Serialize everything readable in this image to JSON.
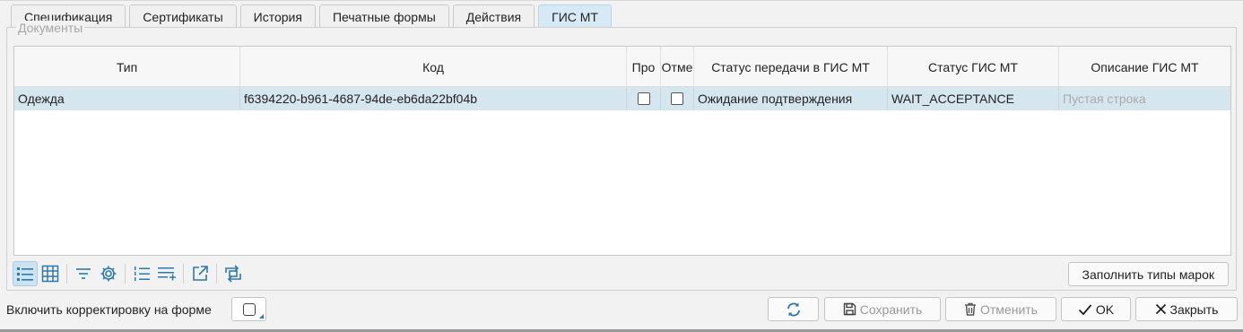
{
  "tabs": [
    {
      "label": "Спецификация"
    },
    {
      "label": "Сертификаты"
    },
    {
      "label": "История"
    },
    {
      "label": "Печатные формы"
    },
    {
      "label": "Действия"
    },
    {
      "label": "ГИС МТ",
      "active": true
    }
  ],
  "group": {
    "title": "Документы"
  },
  "grid": {
    "columns": [
      "Тип",
      "Код",
      "Про",
      "Отме",
      "Статус передачи в ГИС МТ",
      "Статус ГИС МТ",
      "Описание ГИС МТ"
    ],
    "rows": [
      {
        "type": "Одежда",
        "code": "f6394220-b961-4687-94de-eb6da22bf04b",
        "pro": false,
        "otme": false,
        "transfer_status": "Ожидание подтверждения",
        "gis_status": "WAIT_ACCEPTANCE",
        "description_placeholder": "Пустая строка"
      }
    ]
  },
  "toolbar": {
    "icons": [
      "list-view-icon",
      "table-view-icon",
      "filter-icon",
      "settings-gear-icon",
      "numbered-list-icon",
      "add-rows-icon",
      "export-icon",
      "transfer-icon"
    ],
    "fill_button": "Заполнить типы марок"
  },
  "footer": {
    "edit_label": "Включить корректировку на форме",
    "save": "Сохранить",
    "cancel": "Отменить",
    "ok": "OK",
    "close": "Закрыть"
  },
  "colors": {
    "accent": "#2a7ab0",
    "selected_row": "#d6e6ee",
    "active_tab": "#d6eaf5"
  }
}
